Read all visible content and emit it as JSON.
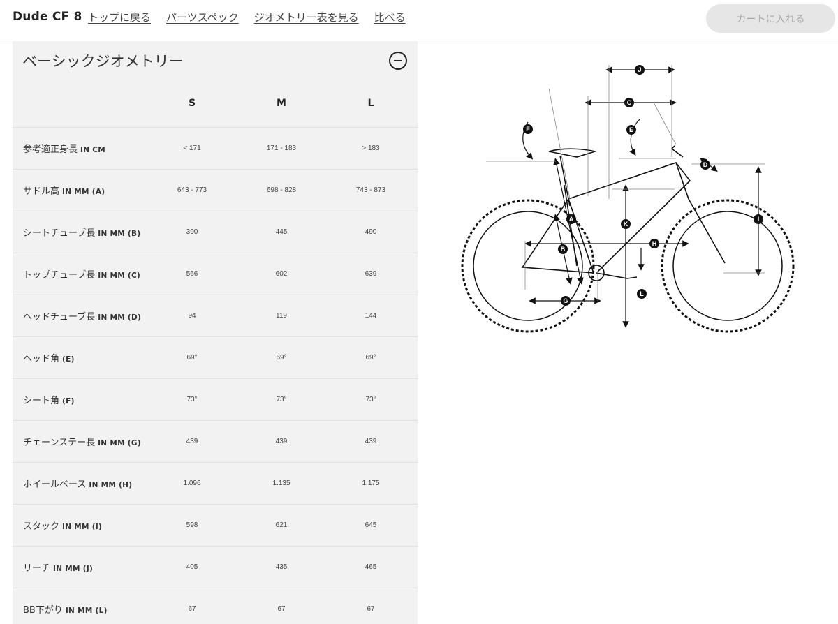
{
  "header": {
    "product_name": "Dude CF 8",
    "nav": [
      "トップに戻る",
      "パーツスペック",
      "ジオメトリー表を見る",
      "比べる"
    ],
    "cart_label": "カートに入れる"
  },
  "geometry": {
    "title": "ベーシックジオメトリー",
    "sizes": [
      "S",
      "M",
      "L"
    ],
    "rows": [
      {
        "label": "参考適正身長",
        "unit": "IN CM",
        "values": [
          "< 171",
          "171 - 183",
          "> 183"
        ]
      },
      {
        "label": "サドル高",
        "unit": "IN MM (A)",
        "values": [
          "643 - 773",
          "698 - 828",
          "743 - 873"
        ]
      },
      {
        "label": "シートチューブ長",
        "unit": "IN MM (B)",
        "values": [
          "390",
          "445",
          "490"
        ]
      },
      {
        "label": "トップチューブ長",
        "unit": "IN MM (C)",
        "values": [
          "566",
          "602",
          "639"
        ]
      },
      {
        "label": "ヘッドチューブ長",
        "unit": "IN MM (D)",
        "values": [
          "94",
          "119",
          "144"
        ]
      },
      {
        "label": "ヘッド角",
        "unit": "(E)",
        "values": [
          "69°",
          "69°",
          "69°"
        ]
      },
      {
        "label": "シート角",
        "unit": "(F)",
        "values": [
          "73°",
          "73°",
          "73°"
        ]
      },
      {
        "label": "チェーンステー長",
        "unit": "IN MM (G)",
        "values": [
          "439",
          "439",
          "439"
        ]
      },
      {
        "label": "ホイールベース",
        "unit": "IN MM (H)",
        "values": [
          "1.096",
          "1.135",
          "1.175"
        ]
      },
      {
        "label": "スタック",
        "unit": "IN MM (I)",
        "values": [
          "598",
          "621",
          "645"
        ]
      },
      {
        "label": "リーチ",
        "unit": "IN MM (J)",
        "values": [
          "405",
          "435",
          "465"
        ]
      },
      {
        "label": "BB下がり",
        "unit": "IN MM (L)",
        "values": [
          "67",
          "67",
          "67"
        ]
      }
    ]
  },
  "diagram": {
    "markers": [
      "A",
      "B",
      "C",
      "D",
      "E",
      "F",
      "G",
      "H",
      "I",
      "J",
      "K",
      "L"
    ]
  }
}
